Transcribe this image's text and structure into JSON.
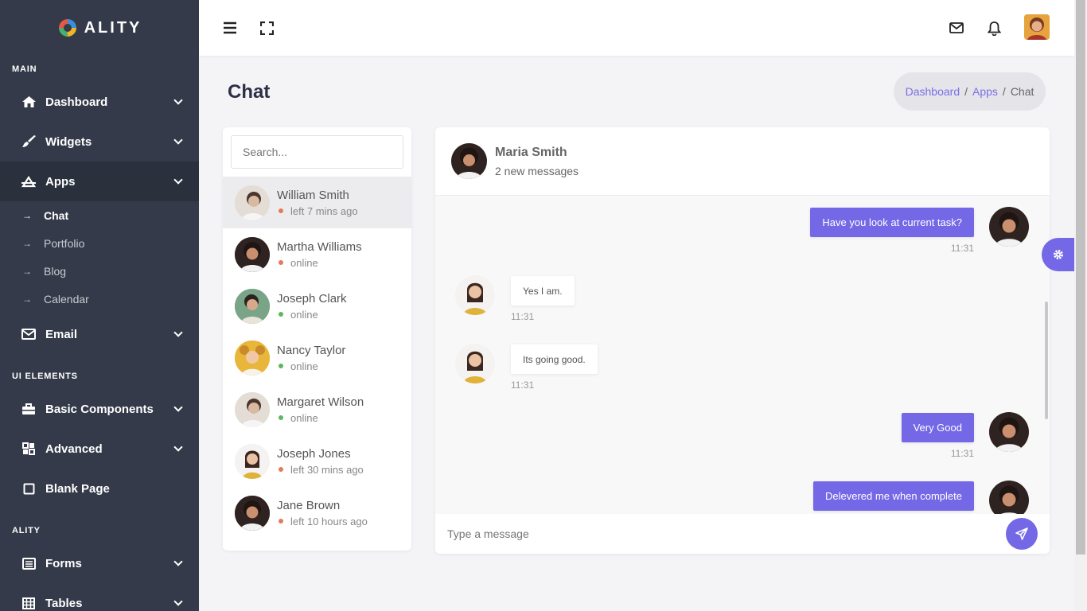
{
  "brand": {
    "name": "ALITY"
  },
  "sidebar": {
    "sections": [
      {
        "label": "MAIN"
      },
      {
        "label": "UI ELEMENTS"
      },
      {
        "label": "ALITY"
      }
    ],
    "items": [
      {
        "label": "Dashboard",
        "icon": "home-icon"
      },
      {
        "label": "Widgets",
        "icon": "brush-icon"
      },
      {
        "label": "Apps",
        "icon": "apps-icon"
      },
      {
        "label": "Email",
        "icon": "envelope-icon"
      },
      {
        "label": "Basic Components",
        "icon": "briefcase-icon"
      },
      {
        "label": "Advanced",
        "icon": "grid-icon"
      },
      {
        "label": "Blank Page",
        "icon": "square-icon"
      },
      {
        "label": "Forms",
        "icon": "form-icon"
      },
      {
        "label": "Tables",
        "icon": "table-icon"
      }
    ],
    "apps_submenu": [
      {
        "label": "Chat",
        "arrow": "→"
      },
      {
        "label": "Portfolio",
        "arrow": "→"
      },
      {
        "label": "Blog",
        "arrow": "→"
      },
      {
        "label": "Calendar",
        "arrow": "→"
      }
    ]
  },
  "page": {
    "title": "Chat"
  },
  "breadcrumb": {
    "items": [
      "Dashboard",
      "Apps",
      "Chat"
    ],
    "separator": "/"
  },
  "contacts": {
    "search_placeholder": "Search...",
    "list": [
      {
        "name": "William Smith",
        "status": "left 7 mins ago",
        "status_color": "#e6785c"
      },
      {
        "name": "Martha Williams",
        "status": "online",
        "status_color": "#e6785c"
      },
      {
        "name": "Joseph Clark",
        "status": "online",
        "status_color": "#5cb85c"
      },
      {
        "name": "Nancy Taylor",
        "status": "online",
        "status_color": "#5cb85c"
      },
      {
        "name": "Margaret Wilson",
        "status": "online",
        "status_color": "#5cb85c"
      },
      {
        "name": "Joseph Jones",
        "status": "left 30 mins ago",
        "status_color": "#e6785c"
      },
      {
        "name": "Jane Brown",
        "status": "left 10 hours ago",
        "status_color": "#e6785c"
      }
    ]
  },
  "chat": {
    "header": {
      "name": "Maria Smith",
      "subtitle": "2 new messages"
    },
    "messages": [
      {
        "text": "Have you look at current task?",
        "time": "11:31",
        "direction": "out"
      },
      {
        "text": "Yes I am.",
        "time": "11:31",
        "direction": "in"
      },
      {
        "text": "Its going good.",
        "time": "11:31",
        "direction": "in"
      },
      {
        "text": "Very Good",
        "time": "11:31",
        "direction": "out"
      },
      {
        "text": "Delevered me when complete",
        "time": "",
        "direction": "out"
      }
    ],
    "input_placeholder": "Type a message"
  },
  "colors": {
    "accent": "#7468e6",
    "sidebar_bg": "#343a49",
    "online": "#5cb85c",
    "away": "#e6785c"
  }
}
